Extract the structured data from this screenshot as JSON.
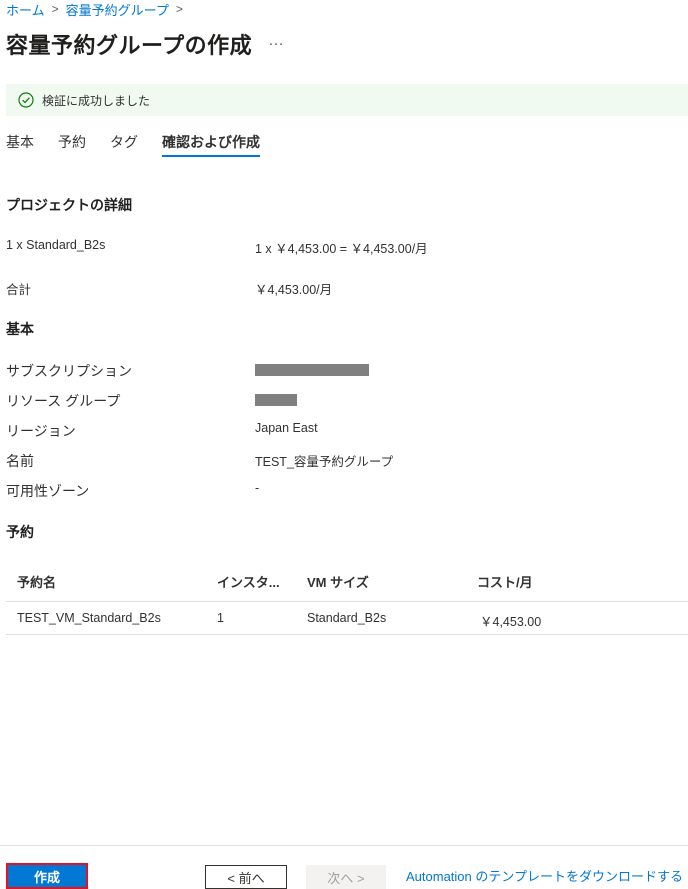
{
  "breadcrumb": {
    "home": "ホーム",
    "parent": "容量予約グループ"
  },
  "page": {
    "title": "容量予約グループの作成",
    "more": "…"
  },
  "banner": {
    "message": "検証に成功しました",
    "color": "#107c10"
  },
  "tabs": [
    {
      "label": "基本"
    },
    {
      "label": "予約"
    },
    {
      "label": "タグ"
    },
    {
      "label": "確認および作成"
    }
  ],
  "project_details": {
    "title": "プロジェクトの詳細",
    "rows": [
      {
        "label": "1 x Standard_B2s",
        "value": "1 x ￥4,453.00 = ￥4,453.00/月"
      },
      {
        "label": "合計",
        "value": "￥4,453.00/月"
      }
    ]
  },
  "basics": {
    "title": "基本",
    "rows": [
      {
        "label": "サブスクリプション",
        "value": ""
      },
      {
        "label": "リソース グループ",
        "value": ""
      },
      {
        "label": "リージョン",
        "value": "Japan East"
      },
      {
        "label": "名前",
        "value": "TEST_容量予約グループ"
      },
      {
        "label": "可用性ゾーン",
        "value": "-"
      }
    ]
  },
  "reservations": {
    "title": "予約",
    "columns": [
      "予約名",
      "インスタ...",
      "VM サイズ",
      "コスト/月"
    ],
    "rows": [
      [
        "TEST_VM_Standard_B2s",
        "1",
        "Standard_B2s",
        "￥4,453.00"
      ]
    ]
  },
  "footer": {
    "create": "作成",
    "prev": "< 前へ",
    "next": "次へ >",
    "download": "Automation のテンプレートをダウンロードする"
  },
  "colors": {
    "accent": "#0078d4",
    "highlight_border": "#e81123"
  }
}
